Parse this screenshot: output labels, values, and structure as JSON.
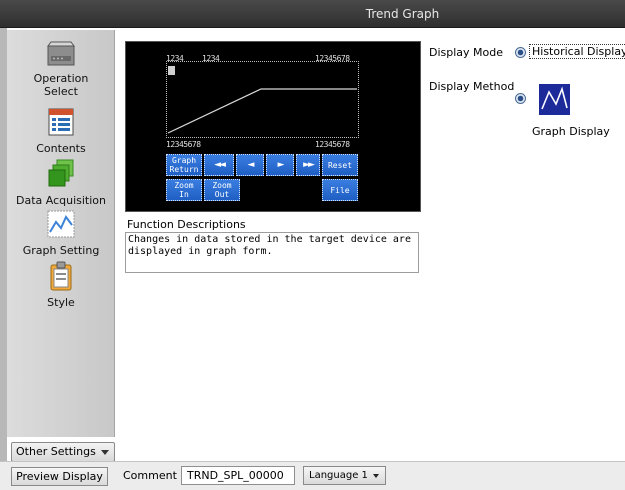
{
  "window": {
    "title": "Trend Graph"
  },
  "sidebar": {
    "items": [
      {
        "label": "Operation\nSelect",
        "icon": "operation-select-icon"
      },
      {
        "label": "Contents",
        "icon": "contents-icon"
      },
      {
        "label": "Data Acquisition",
        "icon": "data-acquisition-icon"
      },
      {
        "label": "Graph Setting",
        "icon": "graph-setting-icon"
      },
      {
        "label": "Style",
        "icon": "style-icon"
      }
    ],
    "other_settings": "Other Settings"
  },
  "preview": {
    "top_left_1": "1234",
    "top_left_2": "1234",
    "top_right": "12345678",
    "bottom_left": "12345678",
    "bottom_right": "12345678",
    "buttons": {
      "graph_return": "Graph\nReturn",
      "fast_back": "◄◄",
      "back": "◄",
      "forward": "►",
      "fast_forward": "►►",
      "reset": "Reset",
      "zoom_in": "Zoom\nIn",
      "zoom_out": "Zoom\nOut",
      "file": "File"
    },
    "colors": {
      "button": "#2a6ad6",
      "background": "#000000",
      "icon_bg": "#1d2b9a"
    }
  },
  "function": {
    "label": "Function Descriptions",
    "text": "Changes in data stored in the target device are displayed in graph form."
  },
  "settings": {
    "display_mode_label": "Display Mode",
    "display_mode_value": "Historical Display",
    "display_method_label": "Display Method",
    "display_method_value": "Graph Display"
  },
  "bottom": {
    "preview_button": "Preview Display",
    "comment_label": "Comment",
    "comment_value": "TRND_SPL_00000",
    "language": "Language 1"
  }
}
